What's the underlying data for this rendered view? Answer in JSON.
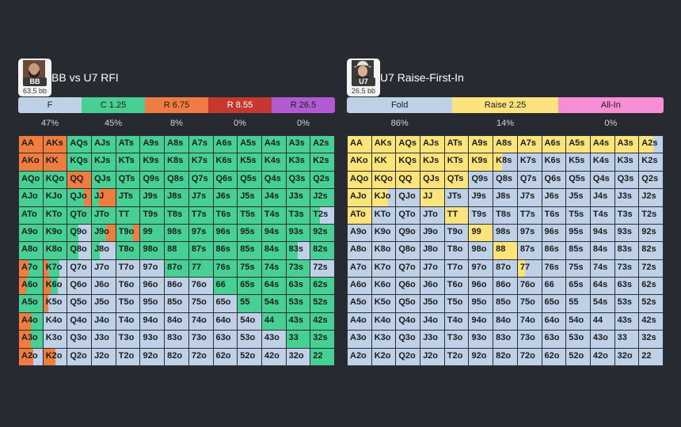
{
  "colors": {
    "fold": "#bfd1e6",
    "call": "#46d093",
    "raise_small": "#f07d3f",
    "raise_mid": "#c8372d",
    "raise_large": "#b25ad4",
    "raise_yellow": "#fbe57b",
    "allin": "#f78dd4"
  },
  "ranks": [
    "A",
    "K",
    "Q",
    "J",
    "T",
    "9",
    "8",
    "7",
    "6",
    "5",
    "4",
    "3",
    "2"
  ],
  "left": {
    "player": {
      "name": "BB",
      "stack": "63.5 bb",
      "avatar_icon": "bearded-man-avatar"
    },
    "title": "BB vs U7 RFI",
    "actions": [
      {
        "label": "F",
        "color": "#bfd1e6"
      },
      {
        "label": "C 1.25",
        "color": "#46d093"
      },
      {
        "label": "R 6.75",
        "color": "#f07d3f"
      },
      {
        "label": "R 8.55",
        "color": "#c8372d"
      },
      {
        "label": "R 26.5",
        "color": "#b25ad4"
      }
    ],
    "freqs": [
      "47%",
      "45%",
      "8%",
      "0%",
      "0%"
    ]
  },
  "right": {
    "player": {
      "name": "U7",
      "stack": "26.5 bb",
      "avatar_icon": "cowboy-hat-avatar"
    },
    "title": "U7 Raise-First-In",
    "actions": [
      {
        "label": "Fold",
        "color": "#bfd1e6"
      },
      {
        "label": "Raise 2.25",
        "color": "#fbe57b"
      },
      {
        "label": "All-In",
        "color": "#f78dd4"
      }
    ],
    "freqs": [
      "86%",
      "14%",
      "0%"
    ]
  }
}
